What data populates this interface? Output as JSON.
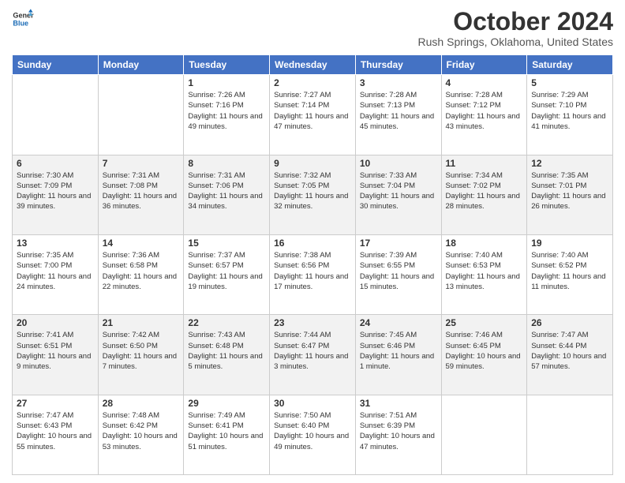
{
  "logo": {
    "line1": "General",
    "line2": "Blue"
  },
  "header": {
    "month": "October 2024",
    "location": "Rush Springs, Oklahoma, United States"
  },
  "weekdays": [
    "Sunday",
    "Monday",
    "Tuesday",
    "Wednesday",
    "Thursday",
    "Friday",
    "Saturday"
  ],
  "weeks": [
    [
      {
        "day": "",
        "info": ""
      },
      {
        "day": "",
        "info": ""
      },
      {
        "day": "1",
        "info": "Sunrise: 7:26 AM\nSunset: 7:16 PM\nDaylight: 11 hours and 49 minutes."
      },
      {
        "day": "2",
        "info": "Sunrise: 7:27 AM\nSunset: 7:14 PM\nDaylight: 11 hours and 47 minutes."
      },
      {
        "day": "3",
        "info": "Sunrise: 7:28 AM\nSunset: 7:13 PM\nDaylight: 11 hours and 45 minutes."
      },
      {
        "day": "4",
        "info": "Sunrise: 7:28 AM\nSunset: 7:12 PM\nDaylight: 11 hours and 43 minutes."
      },
      {
        "day": "5",
        "info": "Sunrise: 7:29 AM\nSunset: 7:10 PM\nDaylight: 11 hours and 41 minutes."
      }
    ],
    [
      {
        "day": "6",
        "info": "Sunrise: 7:30 AM\nSunset: 7:09 PM\nDaylight: 11 hours and 39 minutes."
      },
      {
        "day": "7",
        "info": "Sunrise: 7:31 AM\nSunset: 7:08 PM\nDaylight: 11 hours and 36 minutes."
      },
      {
        "day": "8",
        "info": "Sunrise: 7:31 AM\nSunset: 7:06 PM\nDaylight: 11 hours and 34 minutes."
      },
      {
        "day": "9",
        "info": "Sunrise: 7:32 AM\nSunset: 7:05 PM\nDaylight: 11 hours and 32 minutes."
      },
      {
        "day": "10",
        "info": "Sunrise: 7:33 AM\nSunset: 7:04 PM\nDaylight: 11 hours and 30 minutes."
      },
      {
        "day": "11",
        "info": "Sunrise: 7:34 AM\nSunset: 7:02 PM\nDaylight: 11 hours and 28 minutes."
      },
      {
        "day": "12",
        "info": "Sunrise: 7:35 AM\nSunset: 7:01 PM\nDaylight: 11 hours and 26 minutes."
      }
    ],
    [
      {
        "day": "13",
        "info": "Sunrise: 7:35 AM\nSunset: 7:00 PM\nDaylight: 11 hours and 24 minutes."
      },
      {
        "day": "14",
        "info": "Sunrise: 7:36 AM\nSunset: 6:58 PM\nDaylight: 11 hours and 22 minutes."
      },
      {
        "day": "15",
        "info": "Sunrise: 7:37 AM\nSunset: 6:57 PM\nDaylight: 11 hours and 19 minutes."
      },
      {
        "day": "16",
        "info": "Sunrise: 7:38 AM\nSunset: 6:56 PM\nDaylight: 11 hours and 17 minutes."
      },
      {
        "day": "17",
        "info": "Sunrise: 7:39 AM\nSunset: 6:55 PM\nDaylight: 11 hours and 15 minutes."
      },
      {
        "day": "18",
        "info": "Sunrise: 7:40 AM\nSunset: 6:53 PM\nDaylight: 11 hours and 13 minutes."
      },
      {
        "day": "19",
        "info": "Sunrise: 7:40 AM\nSunset: 6:52 PM\nDaylight: 11 hours and 11 minutes."
      }
    ],
    [
      {
        "day": "20",
        "info": "Sunrise: 7:41 AM\nSunset: 6:51 PM\nDaylight: 11 hours and 9 minutes."
      },
      {
        "day": "21",
        "info": "Sunrise: 7:42 AM\nSunset: 6:50 PM\nDaylight: 11 hours and 7 minutes."
      },
      {
        "day": "22",
        "info": "Sunrise: 7:43 AM\nSunset: 6:48 PM\nDaylight: 11 hours and 5 minutes."
      },
      {
        "day": "23",
        "info": "Sunrise: 7:44 AM\nSunset: 6:47 PM\nDaylight: 11 hours and 3 minutes."
      },
      {
        "day": "24",
        "info": "Sunrise: 7:45 AM\nSunset: 6:46 PM\nDaylight: 11 hours and 1 minute."
      },
      {
        "day": "25",
        "info": "Sunrise: 7:46 AM\nSunset: 6:45 PM\nDaylight: 10 hours and 59 minutes."
      },
      {
        "day": "26",
        "info": "Sunrise: 7:47 AM\nSunset: 6:44 PM\nDaylight: 10 hours and 57 minutes."
      }
    ],
    [
      {
        "day": "27",
        "info": "Sunrise: 7:47 AM\nSunset: 6:43 PM\nDaylight: 10 hours and 55 minutes."
      },
      {
        "day": "28",
        "info": "Sunrise: 7:48 AM\nSunset: 6:42 PM\nDaylight: 10 hours and 53 minutes."
      },
      {
        "day": "29",
        "info": "Sunrise: 7:49 AM\nSunset: 6:41 PM\nDaylight: 10 hours and 51 minutes."
      },
      {
        "day": "30",
        "info": "Sunrise: 7:50 AM\nSunset: 6:40 PM\nDaylight: 10 hours and 49 minutes."
      },
      {
        "day": "31",
        "info": "Sunrise: 7:51 AM\nSunset: 6:39 PM\nDaylight: 10 hours and 47 minutes."
      },
      {
        "day": "",
        "info": ""
      },
      {
        "day": "",
        "info": ""
      }
    ]
  ]
}
